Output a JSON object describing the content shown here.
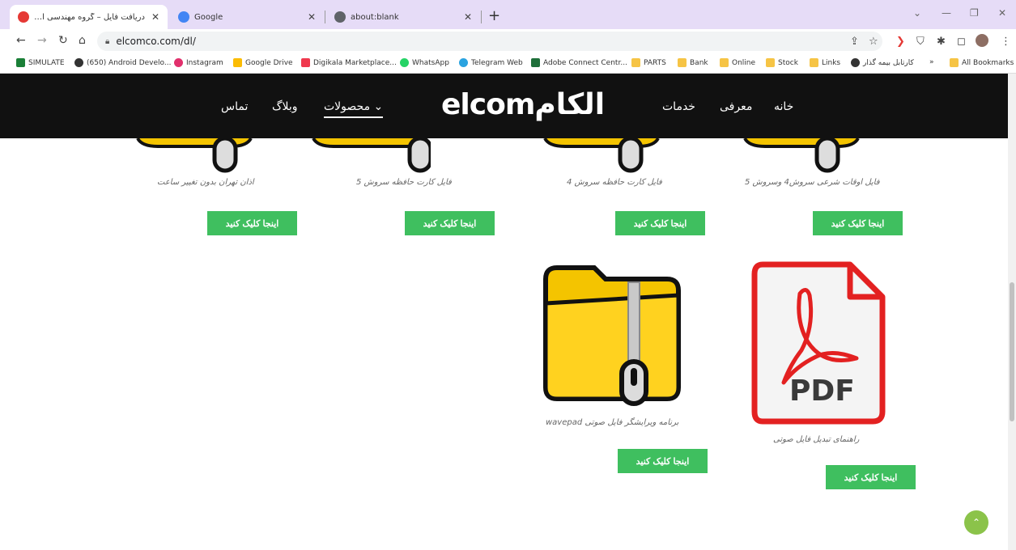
{
  "browser": {
    "tabs": [
      {
        "title": "دریافت فایل – گروه مهندسی الکترونیک",
        "close": "✕",
        "active": true
      },
      {
        "title": "Google",
        "close": "✕",
        "active": false
      },
      {
        "title": "about:blank",
        "close": "✕",
        "active": false
      }
    ],
    "new_tab": "+",
    "url": "elcomco.com/dl/",
    "bookmarks": [
      {
        "label": "SIMULATE",
        "color": "#1a7f37"
      },
      {
        "label": "(650) Android Develo...",
        "color": "#333333"
      },
      {
        "label": "Instagram",
        "color": "#e1306c"
      },
      {
        "label": "Google Drive",
        "color": "#fbbc04"
      },
      {
        "label": "Digikala Marketplace...",
        "color": "#ef394e"
      },
      {
        "label": "WhatsApp",
        "color": "#25d366"
      },
      {
        "label": "Telegram Web",
        "color": "#2aa3e0"
      },
      {
        "label": "Adobe Connect Centr...",
        "color": "#1f6f3a"
      },
      {
        "label": "PARTS",
        "color": "#f6c445"
      },
      {
        "label": "Bank",
        "color": "#f6c445"
      },
      {
        "label": "Online",
        "color": "#f6c445"
      },
      {
        "label": "Stock",
        "color": "#f6c445"
      },
      {
        "label": "Links",
        "color": "#f6c445"
      },
      {
        "label": "کارتابل بیمه گذار",
        "color": "#333333"
      }
    ],
    "more_bookmarks": "»",
    "all_bookmarks": "All Bookmarks"
  },
  "site": {
    "logo": "elcomالکام",
    "menu": {
      "home": "خانه",
      "about": "معرفی",
      "services": "خدمات",
      "products": "محصولات ⌄",
      "blog": "وبلاگ",
      "contact": "تماس"
    },
    "downloads": [
      {
        "caption": "فایل اوقات شرعی سروش4 وسروش 5",
        "button": "اینجا کلیک کنید"
      },
      {
        "caption": "فایل کارت حافظه سروش 4",
        "button": "اینجا کلیک کنید"
      },
      {
        "caption": "فایل کارت حافظه سروش 5",
        "button": "اینجا کلیک کنید"
      },
      {
        "caption": "اذان تهران بدون تغییر ساعت",
        "button": "اینجا کلیک کنید"
      },
      {
        "caption": "راهنمای تبدیل فایل صوتی",
        "button": "اینجا کلیک کنید",
        "icon_text": "PDF"
      },
      {
        "caption": "برنامه ویرایشگر فایل صوتی wavepad",
        "button": "اینجا کلیک کنید"
      }
    ],
    "back_to_top": "⌃"
  }
}
